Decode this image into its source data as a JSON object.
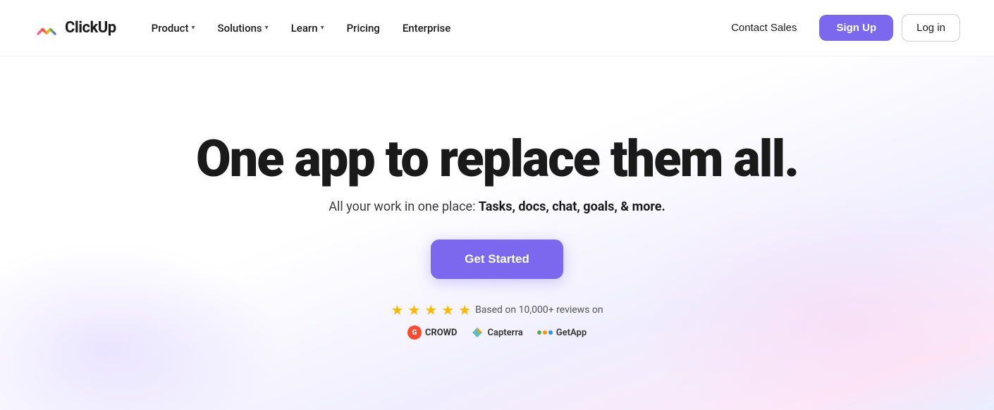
{
  "nav": {
    "logo_text": "ClickUp",
    "product_label": "Product",
    "solutions_label": "Solutions",
    "learn_label": "Learn",
    "pricing_label": "Pricing",
    "enterprise_label": "Enterprise",
    "contact_sales_label": "Contact Sales",
    "signup_label": "Sign Up",
    "login_label": "Log in"
  },
  "hero": {
    "title": "One app to replace them all.",
    "subtitle_prefix": "All your work in one place: ",
    "subtitle_bold": "Tasks, docs, chat, goals, & more.",
    "cta_label": "Get Started"
  },
  "ratings": {
    "stars": [
      "★",
      "★",
      "★",
      "★",
      "★"
    ],
    "review_text": "Based on 10,000+ reviews on",
    "badges": [
      {
        "name": "G2 Crowd",
        "prefix": "G2",
        "suffix": "CROWD"
      },
      {
        "name": "Capterra"
      },
      {
        "name": "GetApp"
      }
    ]
  },
  "colors": {
    "accent": "#7B68EE",
    "star": "#FFB800",
    "capterra": "#55C1C0",
    "getapp1": "#4CAF50",
    "getapp2": "#FF9800",
    "getapp3": "#2196F3"
  }
}
